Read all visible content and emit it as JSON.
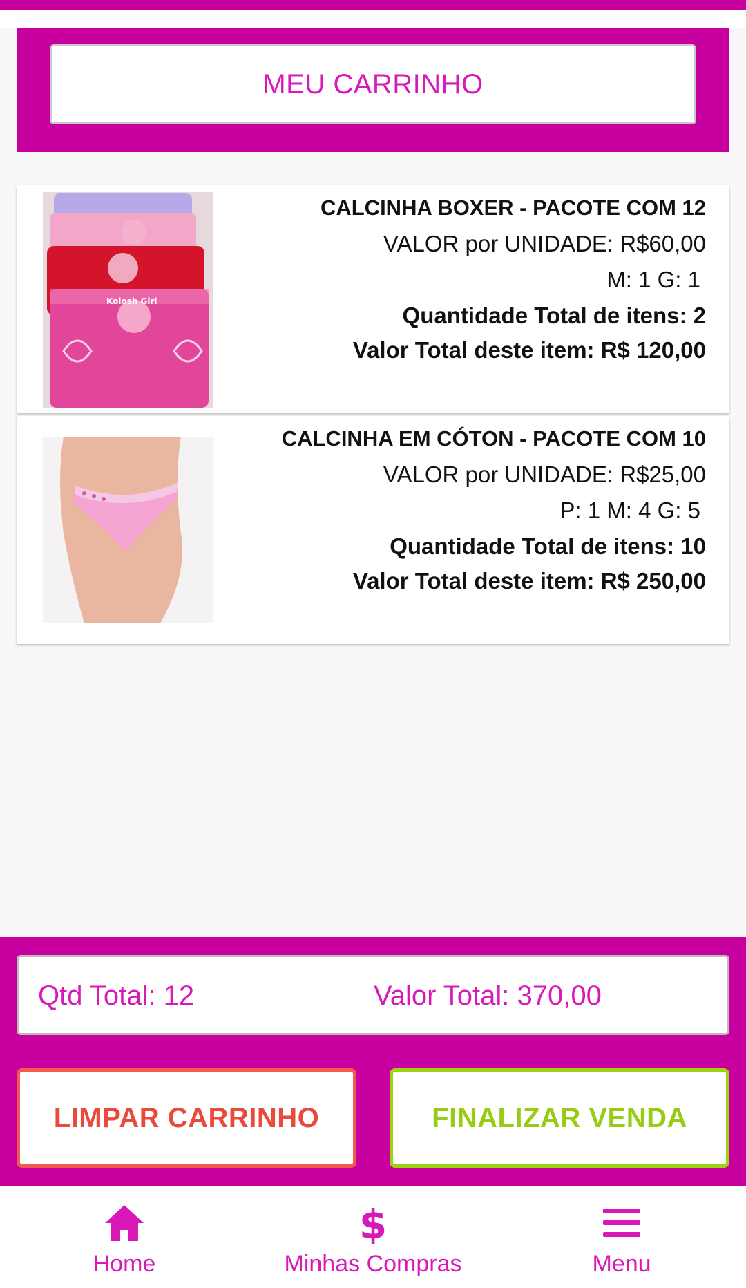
{
  "header": {
    "title": "MEU CARRINHO"
  },
  "cart": {
    "items": [
      {
        "title": "CALCINHA BOXER - PACOTE COM 12",
        "unit_price": "VALOR por UNIDADE: R$60,00",
        "sizes": "M: 1 G: 1",
        "quantity": "Quantidade Total de itens: 2",
        "total": "Valor Total deste item: R$ 120,00",
        "image_label": "Kolosh Girl",
        "colors": [
          "#b9a8e8",
          "#f4a6c9",
          "#d4142a",
          "#e2469a"
        ]
      },
      {
        "title": "CALCINHA EM CÓTON - PACOTE COM 10",
        "unit_price": "VALOR por UNIDADE: R$25,00",
        "sizes": "P: 1 M: 4 G: 5",
        "quantity": "Quantidade Total de itens: 10",
        "total": "Valor Total deste item: R$ 250,00",
        "colors": [
          "#f3a4d3",
          "#e9b7a0"
        ]
      }
    ]
  },
  "summary": {
    "qtd_total": "Qtd Total: 12",
    "valor_total": "Valor Total: 370,00"
  },
  "actions": {
    "clear_label": "LIMPAR CARRINHO",
    "finish_label": "FINALIZAR VENDA"
  },
  "nav": {
    "home": {
      "label": "Home",
      "icon": "home-icon"
    },
    "purchases": {
      "label": "Minhas Compras",
      "icon": "dollar-icon"
    },
    "menu": {
      "label": "Menu",
      "icon": "hamburger-menu-icon"
    }
  },
  "colors": {
    "brand": "#c8009f",
    "accent_text": "#d819b8",
    "danger": "#e84a3c",
    "success": "#96cc13"
  }
}
